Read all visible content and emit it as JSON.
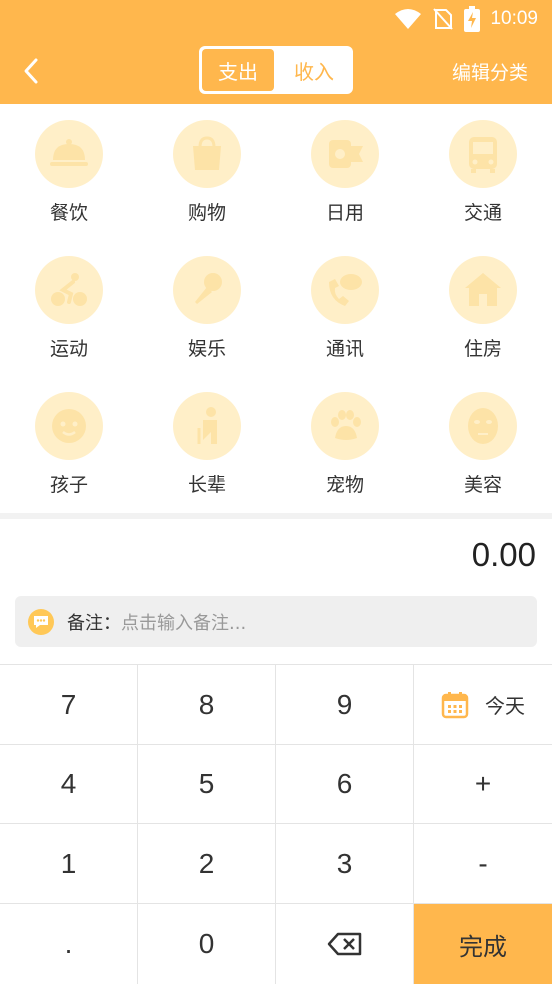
{
  "status": {
    "time": "10:09",
    "icons": [
      "wifi-icon",
      "no-sim-icon",
      "battery-charging-icon"
    ]
  },
  "header": {
    "back_icon": "chevron-left-icon",
    "tabs": [
      {
        "label": "支出",
        "active": true
      },
      {
        "label": "收入",
        "active": false
      }
    ],
    "edit_label": "编辑分类"
  },
  "colors": {
    "accent": "#FFB74D",
    "icon_bg": "#FFEFC8",
    "icon_fg": "#FDE3A7"
  },
  "categories": [
    {
      "label": "餐饮",
      "icon": "food-cloche-icon"
    },
    {
      "label": "购物",
      "icon": "shopping-bag-icon"
    },
    {
      "label": "日用",
      "icon": "toilet-paper-icon"
    },
    {
      "label": "交通",
      "icon": "bus-icon"
    },
    {
      "label": "运动",
      "icon": "cycling-icon"
    },
    {
      "label": "娱乐",
      "icon": "microphone-icon"
    },
    {
      "label": "通讯",
      "icon": "phone-chat-icon"
    },
    {
      "label": "住房",
      "icon": "house-icon"
    },
    {
      "label": "孩子",
      "icon": "baby-face-icon"
    },
    {
      "label": "长辈",
      "icon": "elder-icon"
    },
    {
      "label": "宠物",
      "icon": "paw-icon"
    },
    {
      "label": "美容",
      "icon": "face-mask-icon"
    }
  ],
  "amount": "0.00",
  "note": {
    "label": "备注：",
    "placeholder": "点击输入备注..."
  },
  "keypad": {
    "keys": [
      "7",
      "8",
      "9",
      "4",
      "5",
      "6",
      "1",
      "2",
      "3",
      ".",
      "0"
    ],
    "today": "今天",
    "plus": "+",
    "minus": "-",
    "done": "完成",
    "delete_icon": "backspace-icon",
    "calendar_icon": "calendar-icon"
  }
}
